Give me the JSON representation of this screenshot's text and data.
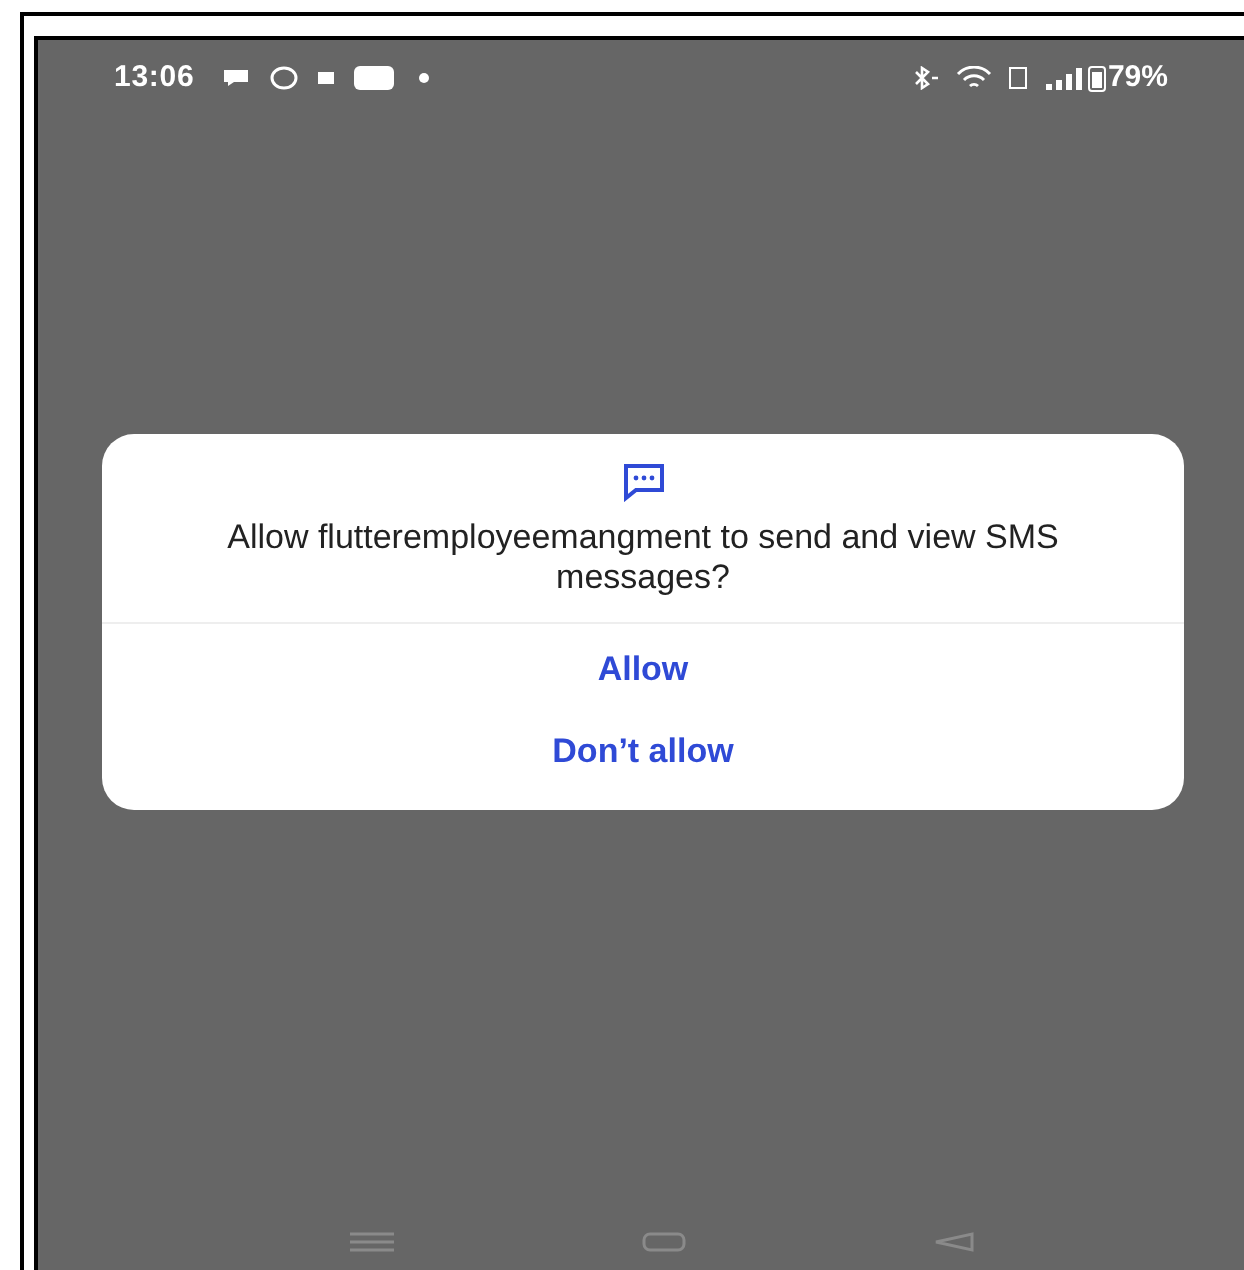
{
  "status_bar": {
    "time": "13:06",
    "battery": "79%"
  },
  "dialog": {
    "message": "Allow flutteremployeemangment to send and view SMS messages?",
    "buttons": [
      "Allow",
      "Don’t allow"
    ]
  }
}
